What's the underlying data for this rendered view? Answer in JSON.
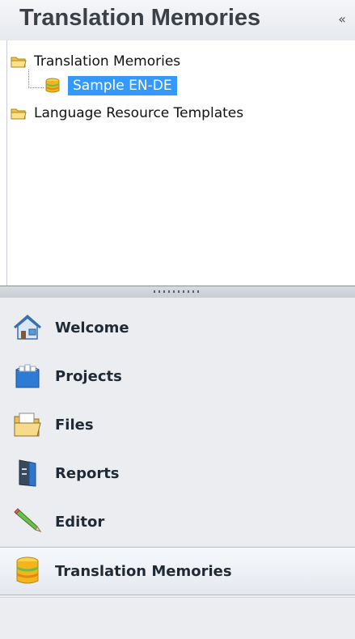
{
  "header": {
    "title": "Translation Memories",
    "collapse_label": "«"
  },
  "tree": {
    "items": [
      {
        "label": "Translation Memories",
        "icon": "folder-icon"
      },
      {
        "label": "Sample EN-DE",
        "icon": "database-icon",
        "selected": true
      },
      {
        "label": "Language Resource Templates",
        "icon": "folder-icon"
      }
    ]
  },
  "nav": {
    "items": [
      {
        "label": "Welcome",
        "icon": "home-icon"
      },
      {
        "label": "Projects",
        "icon": "projects-icon"
      },
      {
        "label": "Files",
        "icon": "files-icon"
      },
      {
        "label": "Reports",
        "icon": "reports-icon"
      },
      {
        "label": "Editor",
        "icon": "pencil-icon"
      },
      {
        "label": "Translation Memories",
        "icon": "database-icon",
        "active": true
      }
    ]
  },
  "colors": {
    "selection": "#3399ff",
    "header_text": "#3a4046",
    "nav_bg": "#ebedf0"
  }
}
